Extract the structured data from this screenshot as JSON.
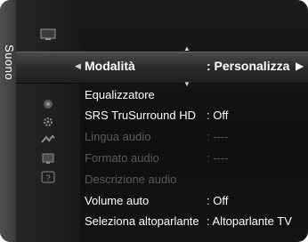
{
  "menu": {
    "category": "Suono",
    "selected": {
      "label": "Modalità",
      "value": ": Personalizza"
    },
    "items": [
      {
        "label": "Equalizzatore",
        "value": ""
      },
      {
        "label": "SRS TruSurround HD",
        "value": ": Off"
      },
      {
        "label": "Lingua audio",
        "value": ": ----"
      },
      {
        "label": "Formato audio",
        "value": ": ----"
      },
      {
        "label": "Descrizione audio",
        "value": ""
      },
      {
        "label": "Volume auto",
        "value": ": Off"
      },
      {
        "label": "Seleziona altoparlante",
        "value": ": Altoparlante TV"
      }
    ],
    "disabled_items": [
      "Lingua audio",
      "Formato audio",
      "Descrizione audio"
    ]
  },
  "icons": [
    "picture-icon",
    "sound-icon",
    "channel-icon",
    "setup-icon",
    "input-icon",
    "application-icon",
    "support-icon"
  ],
  "colors": {
    "panel": "#141414",
    "text": "#ffffff",
    "disabled": "#5a5a5a",
    "highlight": "#3a3a3a"
  }
}
